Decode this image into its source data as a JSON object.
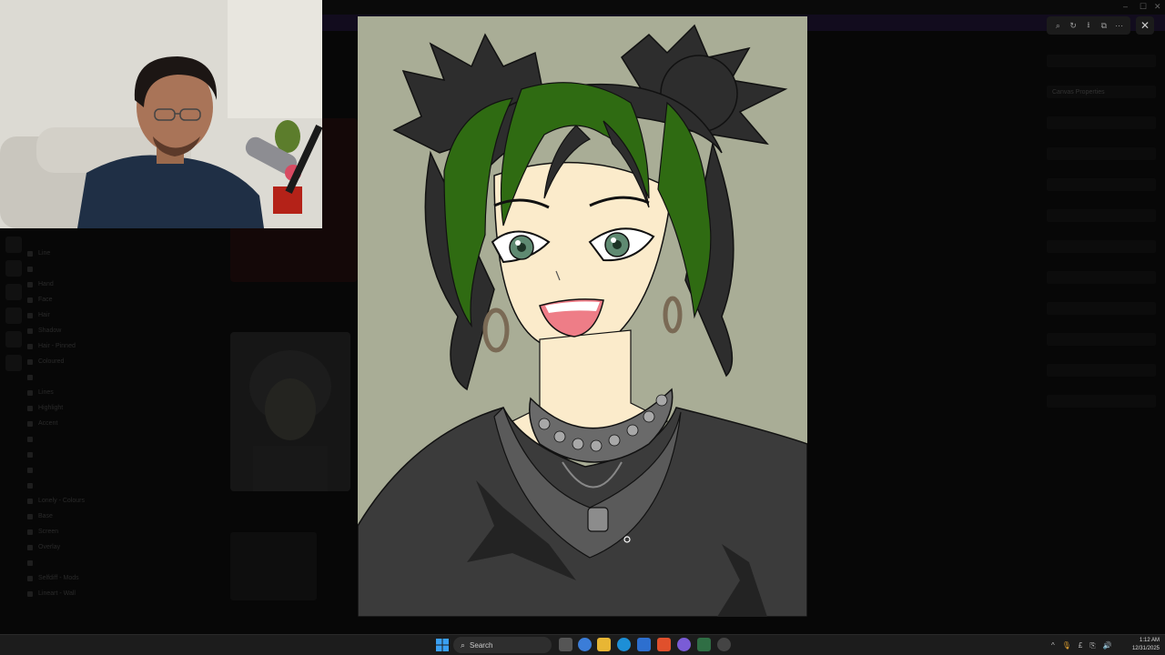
{
  "background_app": {
    "layer_names": [
      "Line",
      "",
      "Hand",
      "Face",
      "Hair",
      "Shadow",
      "Hair - Pinned",
      "Coloured",
      "",
      "Lines",
      "Highlight",
      "Accent",
      "",
      "",
      "",
      "",
      "Lonely - Colours",
      "Base",
      "Screen",
      "Overlay",
      "",
      "Selfdiff - Mods",
      "Lineart - Wall"
    ],
    "right_panel_heading": "Canvas Properties"
  },
  "viewer": {
    "toolbar_icons": [
      "zoom-icon",
      "share-icon",
      "download-icon",
      "open-external-icon",
      "more-icon"
    ],
    "toolbar_glyphs": [
      "⌕",
      "↻",
      "⭳",
      "⧉",
      "⋯"
    ],
    "close_glyph": "✕"
  },
  "taskbar": {
    "search_placeholder": "Search",
    "tray_glyphs": [
      "^",
      "🎙",
      "£",
      "⎘",
      "🔊"
    ],
    "time": "1:12 AM",
    "date": "12/31/2025"
  },
  "colors": {
    "artwork_bg": "#a9ad96",
    "hair_dark": "#2d2d2d",
    "hair_green": "#2f6b12",
    "skin": "#fbebcb",
    "shirt": "#3b3b3b",
    "accent_mouth": "#ee7d87"
  }
}
